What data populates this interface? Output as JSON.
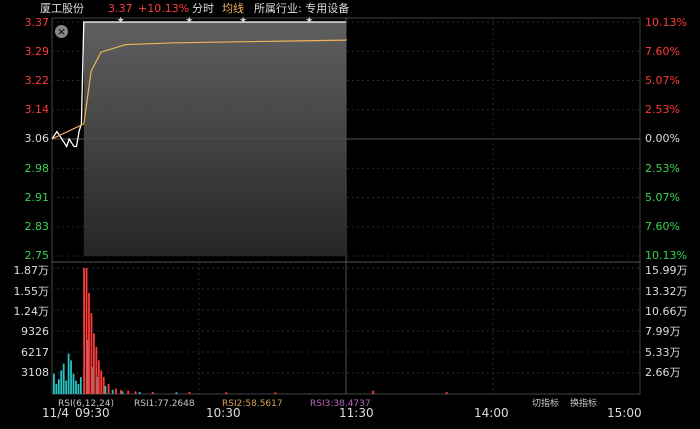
{
  "header": {
    "stock_name": "厦工股份",
    "price": "3.37",
    "change_pct": "+10.13%",
    "tab_intraday": "分时",
    "tab_avg_line": "均线",
    "industry": "所属行业: 专用设备"
  },
  "price_axis_left": [
    "3.37",
    "3.29",
    "3.22",
    "3.14",
    "3.06",
    "2.98",
    "2.91",
    "2.83",
    "2.75"
  ],
  "pct_axis_right": [
    "10.13%",
    "7.60%",
    "5.07%",
    "2.53%",
    "0.00%",
    "2.53%",
    "5.07%",
    "7.60%",
    "10.13%"
  ],
  "volume_axis_left": [
    "1.87万",
    "1.55万",
    "1.24万",
    "9326",
    "6217",
    "3108"
  ],
  "volume_axis_right": [
    "15.99万",
    "13.32万",
    "10.66万",
    "7.99万",
    "5.33万",
    "2.66万"
  ],
  "time_axis": {
    "date": "11/4",
    "open": "09:30",
    "t1030": "10:30",
    "t1130": "11:30",
    "t1400": "14:00",
    "t1500": "15:00"
  },
  "colors": {
    "up": "#ff3b3b",
    "down": "#39d353",
    "neutral": "#dddddd",
    "avg_line": "#f0b35a",
    "price_line": "#ffffff",
    "grid": "#2a2a2a"
  },
  "chart_data": {
    "type": "line",
    "prev_close": 3.06,
    "ylim": [
      2.75,
      3.37
    ],
    "limit_up_price": 3.37,
    "series": [
      {
        "name": "",
        "points": [
          [
            0,
            3.06
          ],
          [
            1,
            3.07
          ],
          [
            2,
            3.08
          ],
          [
            3,
            3.07
          ],
          [
            4,
            3.06
          ],
          [
            5,
            3.05
          ],
          [
            6,
            3.04
          ],
          [
            7,
            3.06
          ],
          [
            8,
            3.05
          ],
          [
            9,
            3.04
          ],
          [
            10,
            3.04
          ],
          [
            11,
            3.08
          ],
          [
            12,
            3.1
          ],
          [
            13,
            3.37
          ],
          [
            240,
            3.37
          ]
        ]
      },
      {
        "name": "",
        "points": [
          [
            0,
            3.06
          ],
          [
            13,
            3.1
          ],
          [
            16,
            3.24
          ],
          [
            20,
            3.29
          ],
          [
            30,
            3.31
          ],
          [
            50,
            3.315
          ],
          [
            100,
            3.32
          ],
          [
            150,
            3.322
          ],
          [
            240,
            3.325
          ]
        ]
      }
    ],
    "volume_ylim": [
      0,
      18700
    ],
    "volume_bars_up": [
      [
        12,
        18700
      ],
      [
        13,
        18700
      ],
      [
        14,
        15000
      ],
      [
        15,
        12000
      ],
      [
        16,
        9000
      ],
      [
        17,
        7000
      ],
      [
        18,
        5000
      ],
      [
        19,
        3500
      ],
      [
        20,
        2500
      ],
      [
        22,
        1500
      ],
      [
        25,
        800
      ],
      [
        27,
        600
      ],
      [
        30,
        500
      ],
      [
        33,
        400
      ],
      [
        40,
        300
      ],
      [
        55,
        300
      ],
      [
        70,
        250
      ],
      [
        90,
        250
      ],
      [
        130,
        500
      ],
      [
        160,
        300
      ]
    ],
    "volume_bars_down": [
      [
        0,
        3000
      ],
      [
        1,
        1500
      ],
      [
        2,
        2200
      ],
      [
        3,
        3500
      ],
      [
        4,
        4500
      ],
      [
        5,
        2000
      ],
      [
        6,
        6000
      ],
      [
        7,
        5000
      ],
      [
        8,
        3000
      ],
      [
        9,
        2000
      ],
      [
        10,
        1500
      ],
      [
        11,
        2500
      ],
      [
        14,
        8000
      ],
      [
        16,
        4000
      ],
      [
        18,
        2500
      ],
      [
        21,
        1200
      ],
      [
        24,
        600
      ],
      [
        28,
        400
      ],
      [
        35,
        300
      ],
      [
        50,
        250
      ]
    ]
  },
  "ticker_bottom": [
    "RSI(6,12,24)",
    "RSI1:77.2648",
    "RSI2:58.5617",
    "RSI3:38.4737",
    "切指标",
    "换指标"
  ]
}
